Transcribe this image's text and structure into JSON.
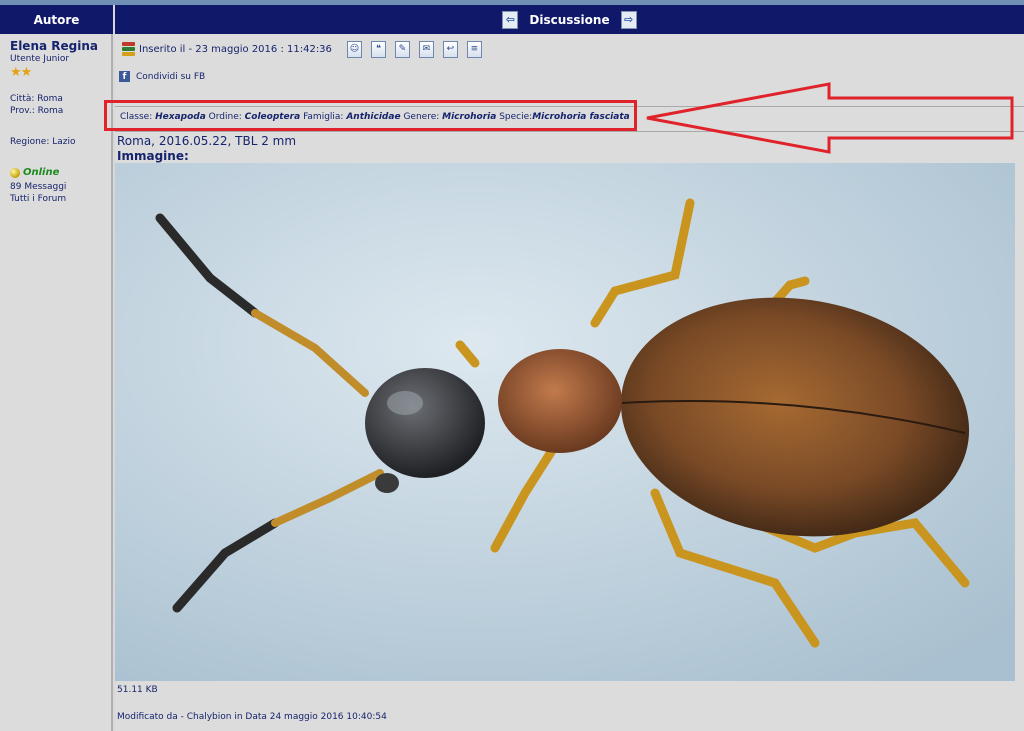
{
  "header": {
    "author_label": "Autore",
    "discussion_label": "Discussione"
  },
  "author": {
    "name": "Elena Regina",
    "rank": "Utente Junior",
    "stars": "★★",
    "city": "Città: Roma",
    "province": "Prov.: Roma",
    "region": "Regione: Lazio",
    "status": "Online",
    "messages": "89 Messaggi",
    "all_forums": "Tutti i Forum"
  },
  "post": {
    "inserted": "Inserito il - 23 maggio 2016 : 11:42:36",
    "share_fb": "Condividi su FB",
    "taxonomy": {
      "classe_label": "Classe:",
      "classe": "Hexapoda",
      "ordine_label": "Ordine:",
      "ordine": "Coleoptera",
      "famiglia_label": "Famiglia:",
      "famiglia": "Anthicidae",
      "genere_label": "Genere:",
      "genere": "Microhoria",
      "specie_label": "Specie:",
      "specie": "Microhoria fasciata"
    },
    "caption": "Roma, 2016.05.22, TBL 2 mm",
    "image_label": "Immagine:",
    "file_size": "51.11 KB",
    "modified": "Modificato da - Chalybion in Data 24 maggio 2016 10:40:54"
  },
  "colors": {
    "header_bg": "#101869",
    "text": "#16246d",
    "highlight": "#e0232a",
    "online": "#1e8a1e"
  },
  "icons": [
    "book-icon",
    "profile-icon",
    "quote-icon",
    "edit-icon",
    "email-icon",
    "reply-icon",
    "book-icon"
  ]
}
